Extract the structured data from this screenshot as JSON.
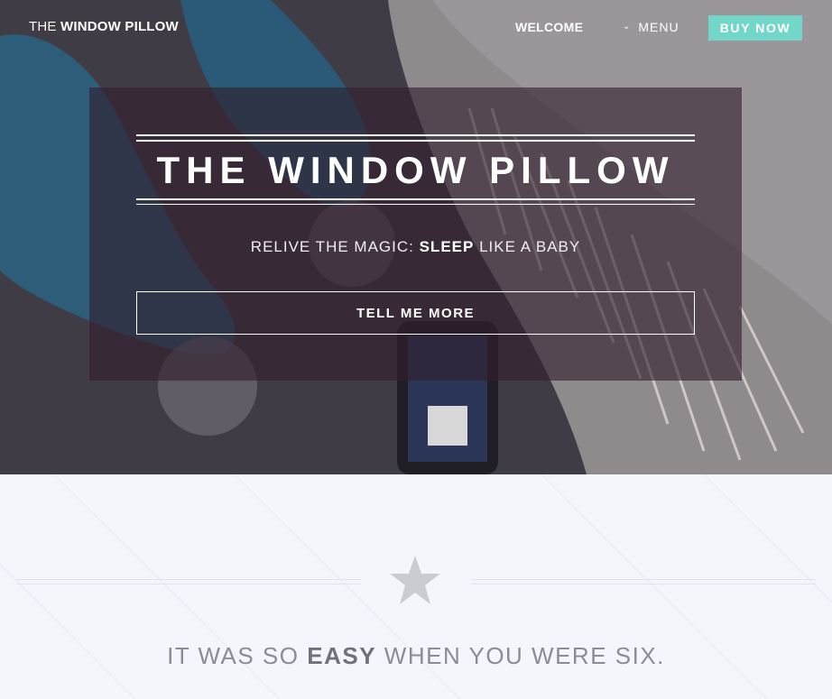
{
  "nav": {
    "brand_prefix": "THE",
    "brand_name": "WINDOW PILLOW",
    "welcome": "WELCOME",
    "menu": "MENU",
    "buy_now": "BUY NOW"
  },
  "hero": {
    "title": "THE WINDOW PILLOW",
    "tagline_prefix": "RELIVE THE MAGIC:",
    "tagline_bold": "SLEEP",
    "tagline_suffix": "LIKE A BABY",
    "cta": "TELL ME MORE"
  },
  "section": {
    "heading_prefix": "IT WAS SO",
    "heading_bold": "EASY",
    "heading_suffix": "WHEN YOU WERE SIX."
  },
  "icons": {
    "chevron": "chevron-down-icon",
    "star": "star-icon"
  },
  "colors": {
    "accent": "#72d6c9",
    "hero_overlay": "#3a2838",
    "section_bg": "#f3f6fa",
    "star": "#c9cdd2"
  }
}
